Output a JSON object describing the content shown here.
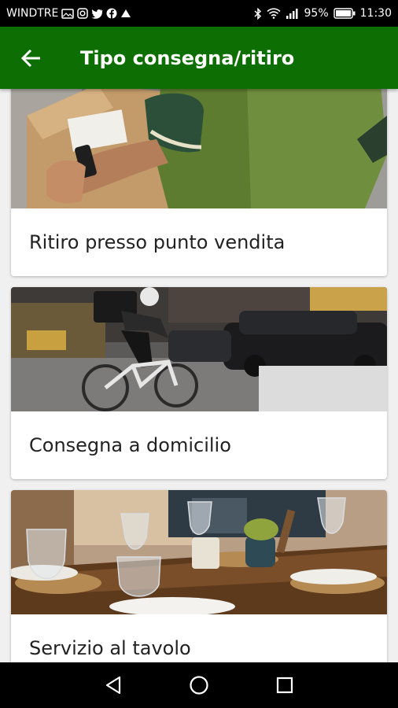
{
  "status_bar": {
    "carrier": "WINDTRE",
    "battery": "95%",
    "time": "11:30"
  },
  "app_bar": {
    "title": "Tipo consegna/ritiro",
    "color": "#0d6e03"
  },
  "options": [
    {
      "label": "Ritiro presso punto vendita"
    },
    {
      "label": "Consegna a domicilio"
    },
    {
      "label": "Servizio al tavolo"
    }
  ]
}
